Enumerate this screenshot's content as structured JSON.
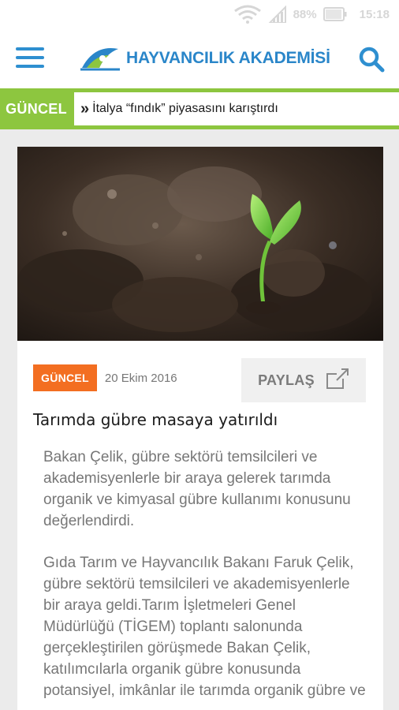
{
  "status_bar": {
    "battery": "88%",
    "time": "15:18"
  },
  "header": {
    "logo_text": "HAYVANCILIK AKADEMİSİ"
  },
  "ticker": {
    "label": "GÜNCEL",
    "headline": "İtalya “fındık” piyasasını karıştırdı"
  },
  "article": {
    "category": "GÜNCEL",
    "date": "20 Ekim 2016",
    "share_label": "PAYLAŞ",
    "title": "Tarımda gübre masaya yatırıldı",
    "summary": "Bakan Çelik, gübre sektörü temsilcileri ve akademisyenlerle bir araya gelerek tarımda organik ve kimyasal gübre kullanımı konusunu değerlendirdi.",
    "body": "Gıda Tarım ve Hayvancılık Bakanı Faruk Çelik, gübre sektörü temsilcileri ve akademisyenlerle bir araya geldi.Tarım İşletmeleri Genel Müdürlüğü (TİGEM) toplantı salonunda gerçekleştirilen görüşmede Bakan Çelik, katılımcılarla organik gübre konusunda potansiyel, imkânlar ile tarımda organik gübre ve"
  },
  "colors": {
    "accent_blue": "#2a86c9",
    "ticker_green": "#8dc63f",
    "badge_orange": "#f36e21"
  },
  "icons": [
    "wifi-icon",
    "signal-icon",
    "battery-icon",
    "menu-icon",
    "logo-icon",
    "search-icon",
    "double-chevron-right-icon",
    "share-icon"
  ]
}
